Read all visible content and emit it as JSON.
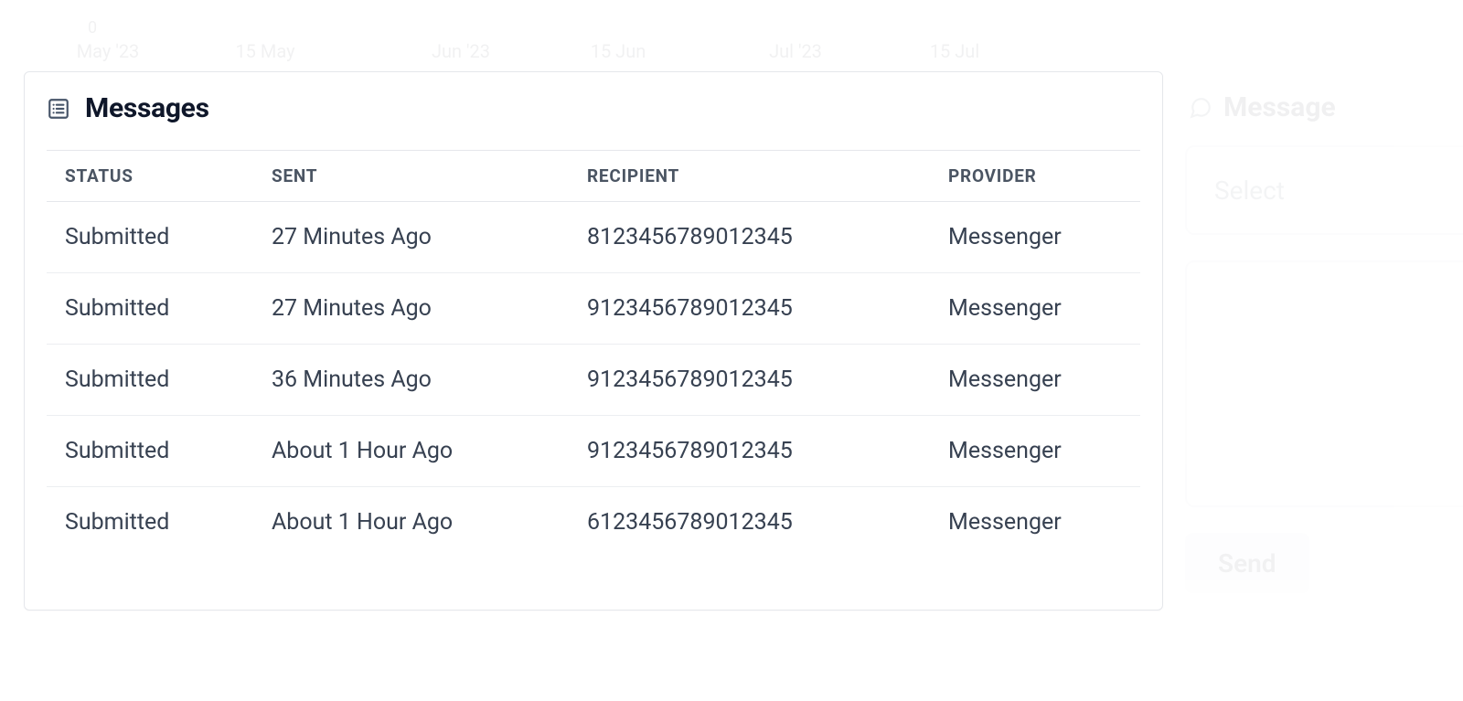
{
  "chart_bg": {
    "y0": "0",
    "xticks": {
      "t0": "May '23",
      "t1": "15 May",
      "t2": "Jun '23",
      "t3": "15 Jun",
      "t4": "Jul '23",
      "t5": "15 Jul"
    }
  },
  "card": {
    "title": "Messages"
  },
  "table": {
    "headers": {
      "status": "STATUS",
      "sent": "SENT",
      "recipient": "RECIPIENT",
      "provider": "PROVIDER"
    },
    "rows": [
      {
        "status": "Submitted",
        "sent": "27 Minutes Ago",
        "recipient": "8123456789012345",
        "provider": "Messenger"
      },
      {
        "status": "Submitted",
        "sent": "27 Minutes Ago",
        "recipient": "9123456789012345",
        "provider": "Messenger"
      },
      {
        "status": "Submitted",
        "sent": "36 Minutes Ago",
        "recipient": "9123456789012345",
        "provider": "Messenger"
      },
      {
        "status": "Submitted",
        "sent": "About 1 Hour Ago",
        "recipient": "9123456789012345",
        "provider": "Messenger"
      },
      {
        "status": "Submitted",
        "sent": "About 1 Hour Ago",
        "recipient": "6123456789012345",
        "provider": "Messenger"
      }
    ]
  },
  "side": {
    "title": "Message",
    "select_placeholder": "Select",
    "send_label": "Send"
  }
}
